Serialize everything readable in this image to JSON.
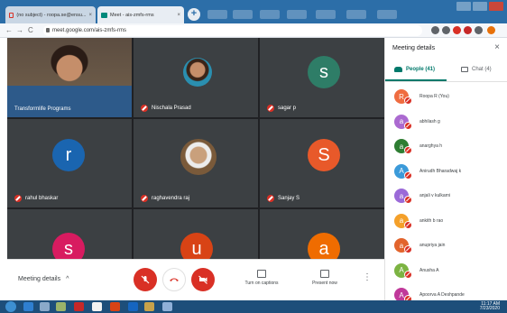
{
  "browser": {
    "tabs": [
      {
        "title": "(no subject) - roopa.se@ensu...",
        "close": "×"
      },
      {
        "title": "Meet - ais-zmfs-rms",
        "close": "×"
      }
    ],
    "new_tab": "+",
    "url": "meet.google.com/ais-zmfs-rms",
    "nav_back": "←",
    "nav_forward": "→",
    "nav_reload": "C"
  },
  "meeting": {
    "tiles": [
      {
        "name": "Transformlife Programs",
        "kind": "video"
      },
      {
        "name": "Nischala Prasad",
        "kind": "photo"
      },
      {
        "name": "sagar p",
        "kind": "letter",
        "letter": "s",
        "color": "#2e7d67"
      },
      {
        "name": "rahul bhaskar",
        "kind": "letter",
        "letter": "r",
        "color": "#1a65b0"
      },
      {
        "name": "raghavendra raj",
        "kind": "photo2"
      },
      {
        "name": "Sanjay S",
        "kind": "letter",
        "letter": "S",
        "color": "#e8592a"
      },
      {
        "name": "",
        "kind": "letter",
        "letter": "s",
        "color": "#d81b60"
      },
      {
        "name": "",
        "kind": "letter",
        "letter": "u",
        "color": "#d84315"
      },
      {
        "name": "",
        "kind": "letter",
        "letter": "a",
        "color": "#ef6c00"
      }
    ],
    "bar": {
      "meeting_details": "Meeting details",
      "meeting_details_chevron": "^",
      "turn_on_captions": "Turn on captions",
      "present_now": "Present now",
      "more": "⋮"
    }
  },
  "panel": {
    "title": "Meeting details",
    "close": "×",
    "tab_people": "People (41)",
    "tab_chat": "Chat (4)",
    "people": [
      {
        "name": "Roopa R (You)",
        "initial": "R",
        "color": "#ef6c40"
      },
      {
        "name": "abhilash g",
        "initial": "a",
        "color": "#ab6ad0"
      },
      {
        "name": "anarghya h",
        "initial": "a",
        "color": "#2e7d32"
      },
      {
        "name": "Anirudh Bharadwaj k",
        "initial": "A",
        "color": "#3b9ad9"
      },
      {
        "name": "anjali v kulkarni",
        "initial": "a",
        "color": "#9b6ad8"
      },
      {
        "name": "ankith b rao",
        "initial": "a",
        "color": "#f4a02a"
      },
      {
        "name": "anupriya jain",
        "initial": "a",
        "color": "#e2642c"
      },
      {
        "name": "Anusha A",
        "initial": "A",
        "color": "#7cb342"
      },
      {
        "name": "Apoorva A Deshpande",
        "initial": "A",
        "color": "#c0399a"
      }
    ]
  },
  "taskbar": {
    "time": "11:17 AM",
    "date": "7/23/2020"
  }
}
